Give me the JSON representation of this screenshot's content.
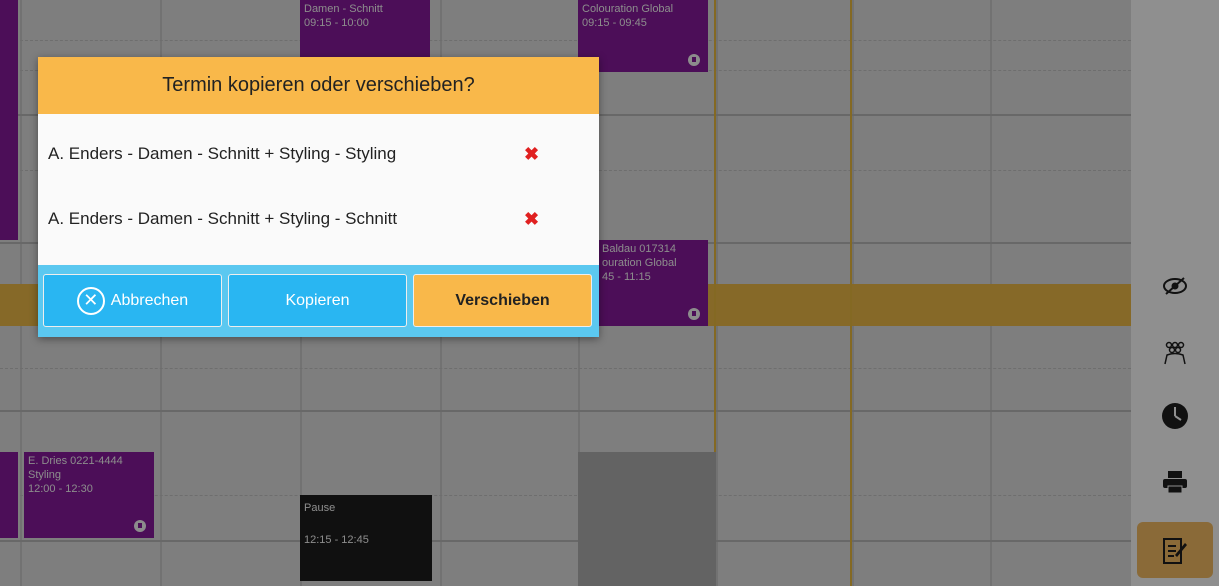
{
  "calendar": {
    "appointments": [
      {
        "id": "a1",
        "line1": "Damen - Schnitt",
        "line2": "09:15 - 10:00",
        "style": "purple"
      },
      {
        "id": "a2",
        "line1": "Colouration Global",
        "line2": "09:15 - 09:45",
        "style": "purple"
      },
      {
        "id": "a3",
        "line1": "Baldau 017314",
        "line2": "ouration Global",
        "line3": "45 - 11:15",
        "style": "purple"
      },
      {
        "id": "a4",
        "line1": "E. Dries 0221-4444",
        "line2": "Styling",
        "line3": "12:00 - 12:30",
        "style": "purple"
      },
      {
        "id": "a5",
        "line1": "Pause",
        "line2": "12:15 - 12:45",
        "style": "dark"
      }
    ],
    "colors": {
      "accent_gold": "#f0c040",
      "appointment_purple": "#8a1aa0"
    }
  },
  "toolbar": {
    "icons": [
      "eye-slash-icon",
      "people-icon",
      "clock-icon",
      "printer-icon",
      "notepad-edit-icon"
    ]
  },
  "dialog": {
    "title": "Termin kopieren oder verschieben?",
    "items": [
      {
        "label": "A. Enders - Damen - Schnitt + Styling  - Styling",
        "remove": "✖"
      },
      {
        "label": "A. Enders - Damen - Schnitt + Styling  - Schnitt",
        "remove": "✖"
      }
    ],
    "buttons": {
      "cancel": "Abbrechen",
      "copy": "Kopieren",
      "move": "Verschieben"
    }
  }
}
